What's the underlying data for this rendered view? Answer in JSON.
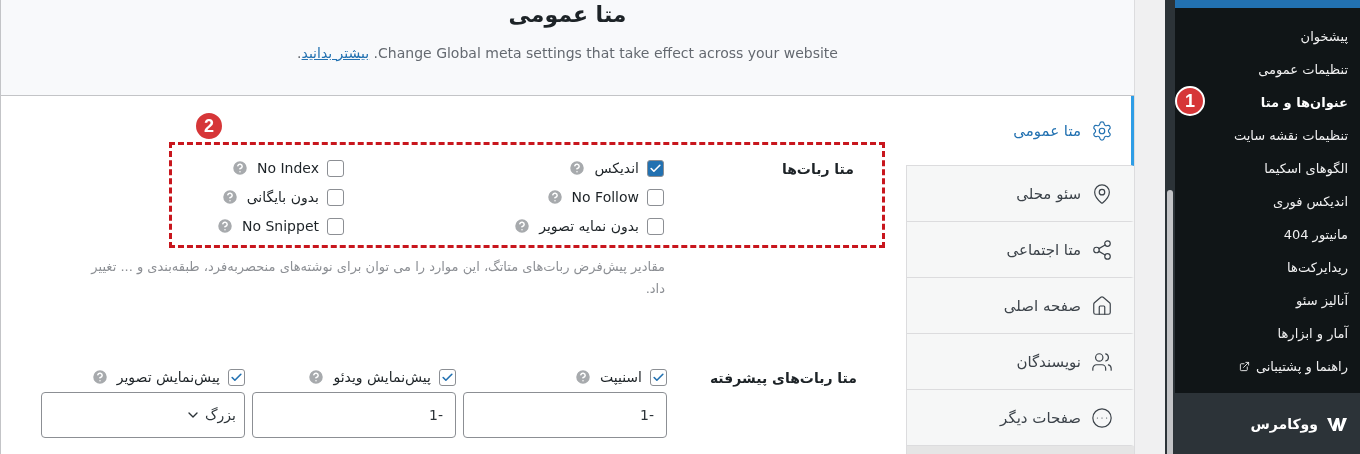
{
  "header": {
    "title": "متا عمومی",
    "description": "Change Global meta settings that take effect across your website. ",
    "link": "بیشتر بدانید",
    "end": "."
  },
  "tabs": [
    {
      "label": "متا عمومی",
      "selected": true
    },
    {
      "label": "سئو محلی",
      "selected": false
    },
    {
      "label": "متا اجتماعی",
      "selected": false
    },
    {
      "label": "صفحه اصلی",
      "selected": false
    },
    {
      "label": "نویسندگان",
      "selected": false
    },
    {
      "label": "صفحات دیگر",
      "selected": false
    }
  ],
  "robots_meta": {
    "label": "متا ربات‌ها",
    "badge": "2",
    "options": [
      {
        "label": "اندیکس",
        "checked": true
      },
      {
        "label": "No Index",
        "checked": false
      },
      {
        "label": "No Follow",
        "checked": false
      },
      {
        "label": "بدون بایگانی",
        "checked": false
      },
      {
        "label": "بدون نمایه تصویر",
        "checked": false
      },
      {
        "label": "No Snippet",
        "checked": false
      }
    ],
    "help": "مقادیر پیش‌فرض ربات‌های متاتگ، این موارد را می توان برای نوشته‌های منحصربه‌فرد، طبقه‌بندی و ... تغییر داد."
  },
  "advanced_robots": {
    "label": "متا ربات‌های پیشرفته",
    "options": [
      {
        "label": "اسنیپت",
        "checked": true,
        "kind": "input",
        "value": "-1"
      },
      {
        "label": "پیش‌نمایش ویدئو",
        "checked": true,
        "kind": "input",
        "value": "-1"
      },
      {
        "label": "پیش‌نمایش تصویر",
        "checked": true,
        "kind": "select",
        "value": "بزرگ"
      }
    ]
  },
  "sidebar": {
    "items": [
      {
        "label": "پیشخوان",
        "selected": false
      },
      {
        "label": "تنظیمات عمومی",
        "selected": false
      },
      {
        "label": "عنوان‌ها و متا",
        "selected": true,
        "badge": "1"
      },
      {
        "label": "تنظیمات نقشه سایت",
        "selected": false
      },
      {
        "label": "الگوهای اسکیما",
        "selected": false
      },
      {
        "label": "اندیکس فوری",
        "selected": false
      },
      {
        "label": "مانیتور 404",
        "selected": false
      },
      {
        "label": "ریدایرکت‌ها",
        "selected": false
      },
      {
        "label": "آنالیز سئو",
        "selected": false
      },
      {
        "label": "آمار و ابزارها",
        "selected": false
      },
      {
        "label": "راهنما و پشتیبانی",
        "selected": false,
        "external": true
      }
    ],
    "section": {
      "label": "ووکامرس"
    }
  }
}
